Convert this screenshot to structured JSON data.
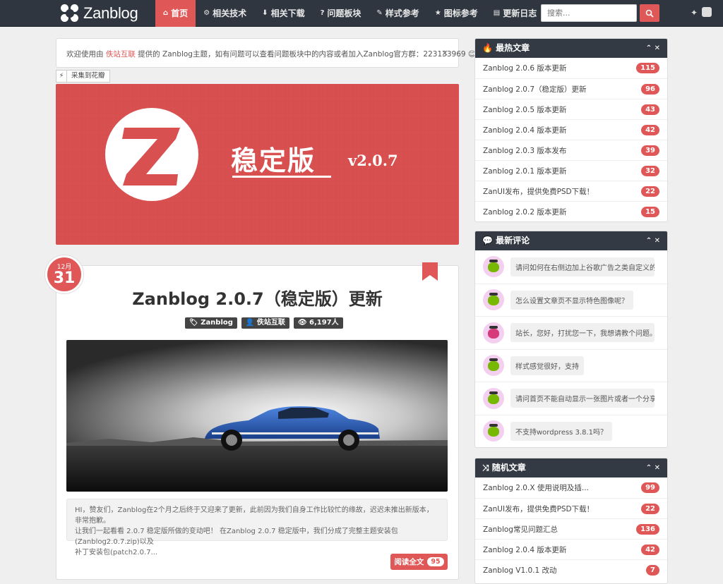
{
  "brand": {
    "name": "Zanblog"
  },
  "nav": {
    "items": [
      {
        "icon": "home-icon",
        "label": "首页",
        "active": true
      },
      {
        "icon": "gear-icon",
        "label": "相关技术"
      },
      {
        "icon": "download-icon",
        "label": "相关下载"
      },
      {
        "icon": "question-icon",
        "label": "问题板块"
      },
      {
        "icon": "brush-icon",
        "label": "样式参考"
      },
      {
        "icon": "star-icon",
        "label": "图标参考"
      },
      {
        "icon": "book-icon",
        "label": "更新日志"
      }
    ],
    "search_placeholder": "搜索..."
  },
  "notice": {
    "before": "欢迎使用由 ",
    "link": "佚站互联",
    "after": " 提供的 Zanblog主题，如有问题可以查看问题板块中的内容或者加入Zanblog官方群：223133969 ☺",
    "close": "×"
  },
  "huaban": {
    "label": "采集到花瓣"
  },
  "banner": {
    "title": "稳定版",
    "version": "v2.0.7",
    "accent": "#d85050"
  },
  "post": {
    "month": "12月",
    "day": "31",
    "title": "Zanblog 2.0.7（稳定版）更新",
    "tags": [
      {
        "icon": "tag-icon",
        "label": "Zanblog"
      },
      {
        "icon": "user-icon",
        "label": "佚站互联"
      },
      {
        "icon": "eye-icon",
        "label": "6,197人"
      }
    ],
    "excerpt_line1": "HI，赞友们，Zanblog在2个月之后终于又迎来了更新，此前因为我们自身工作比较忙的缘故，迟迟未推出新版本，非常抱歉。",
    "excerpt_line2": "让我们一起看看 2.0.7 稳定版所做的变动吧！ 在Zanblog 2.0.7 稳定版中，我们分成了完整主题安装包(Zanblog2.0.7.zip)以及",
    "excerpt_line3": "补丁安装包(patch2.0.7...",
    "readmore": "阅读全文",
    "comments": "95"
  },
  "hot": {
    "title": "最热文章",
    "items": [
      {
        "title": "Zanblog 2.0.6 版本更新",
        "count": "115"
      },
      {
        "title": "Zanblog 2.0.7（稳定版）更新",
        "count": "96"
      },
      {
        "title": "Zanblog 2.0.5 版本更新",
        "count": "43"
      },
      {
        "title": "Zanblog 2.0.4 版本更新",
        "count": "42"
      },
      {
        "title": "Zanblog 2.0.3 版本发布",
        "count": "39"
      },
      {
        "title": "Zanblog 2.0.1 版本更新",
        "count": "32"
      },
      {
        "title": "ZanUI发布，提供免费PSD下载！",
        "count": "22"
      },
      {
        "title": "Zanblog 2.0.2 版本更新",
        "count": "15"
      }
    ]
  },
  "comments": {
    "title": "最新评论",
    "items": [
      {
        "text": "请问如何在右侧边加上谷歌广告之类自定义的...",
        "avatar": "green"
      },
      {
        "text": "怎么设置文章页不显示特色图像呢？",
        "avatar": "green"
      },
      {
        "text": "站长，您好，打扰您一下，我想请教个问题。...",
        "avatar": "pink"
      },
      {
        "text": "样式感觉很好，支持",
        "avatar": "green"
      },
      {
        "text": "请问首页不能自动显示一张图片或者一个分享...",
        "avatar": "green"
      },
      {
        "text": "不支持wordpress 3.8.1吗？",
        "avatar": "green"
      }
    ]
  },
  "random": {
    "title": "随机文章",
    "items": [
      {
        "title": "Zanblog 2.0.X 使用说明及插...",
        "count": "99"
      },
      {
        "title": "ZanUI发布，提供免费PSD下载！",
        "count": "22"
      },
      {
        "title": "Zanblog常见问题汇总",
        "count": "136"
      },
      {
        "title": "Zanblog 2.0.4 版本更新",
        "count": "42"
      },
      {
        "title": "Zanblog V1.0.1 改动",
        "count": "7"
      }
    ]
  }
}
